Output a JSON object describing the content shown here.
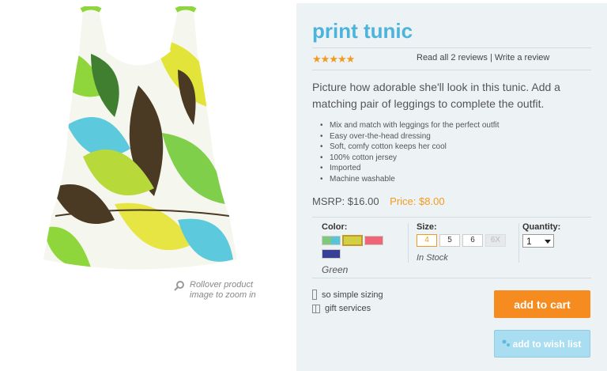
{
  "product": {
    "title": "print tunic",
    "rating_stars": 5,
    "reviews_text": "Read all 2 reviews",
    "write_review": "Write a review",
    "separator": "|",
    "description": "Picture how adorable she'll look in this tunic. Add a matching pair of leggings to complete the outfit.",
    "features": [
      "Mix and match with leggings for the perfect outfit",
      "Easy over-the-head dressing",
      "Soft, comfy cotton keeps her cool",
      "100% cotton jersey",
      "Imported",
      "Machine washable"
    ],
    "msrp": "MSRP: $16.00",
    "price": "Price: $8.00"
  },
  "image": {
    "zoom_hint_line1": "Rollover product",
    "zoom_hint_line2": "image to zoom in"
  },
  "options": {
    "color_label": "Color:",
    "selected_color": "Green",
    "swatches": [
      {
        "name": "multicolor",
        "colors": [
          "#7fc77a",
          "#5bc3d6"
        ]
      },
      {
        "name": "green",
        "colors": [
          "#c9c93a",
          "#d6d24a"
        ],
        "selected": true
      },
      {
        "name": "coral",
        "colors": [
          "#ef6577",
          "#ef6577"
        ]
      },
      {
        "name": "navy",
        "colors": [
          "#3a3f96",
          "#3a3f96"
        ]
      }
    ],
    "size_label": "Size:",
    "sizes": [
      {
        "label": "4",
        "state": "selected"
      },
      {
        "label": "5",
        "state": "available"
      },
      {
        "label": "6",
        "state": "available"
      },
      {
        "label": "6X",
        "state": "disabled"
      }
    ],
    "stock_status": "In Stock",
    "quantity_label": "Quantity:",
    "quantity_value": "1"
  },
  "extras": {
    "sizing": "so simple sizing",
    "gift": "gift services"
  },
  "buttons": {
    "add_to_cart": "add to cart",
    "add_to_wishlist": "add to wish list"
  },
  "colors": {
    "accent_blue": "#4cb3dc",
    "accent_orange": "#f39a1e",
    "cart_orange": "#f68b1f",
    "wish_blue": "#a9def2",
    "panel_bg": "#edf3f5"
  }
}
